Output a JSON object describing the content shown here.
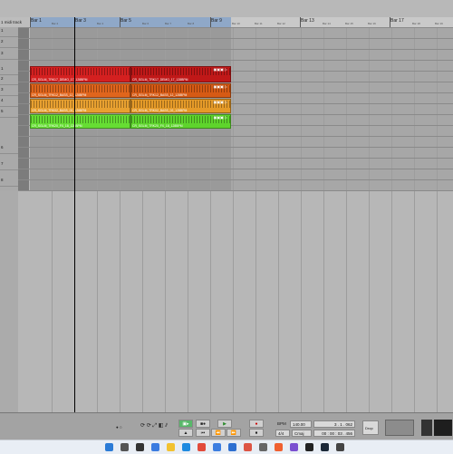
{
  "header": {
    "midi_label": "1 midi track"
  },
  "ruler": {
    "bars": [
      "Bar 1",
      "Bar 3",
      "Bar 5",
      "Bar 9",
      "Bar 13",
      "Bar 17"
    ],
    "beats": [
      "Bar 2",
      "Bar 4",
      "Bar 6",
      "Bar 7",
      "Bar 8",
      "Bar 10",
      "Bar 11",
      "Bar 12",
      "Bar 14",
      "Bar 15",
      "Bar 16",
      "Bar 18",
      "Bar 19"
    ]
  },
  "tracks": [
    "1",
    "2",
    "3",
    "1",
    "2",
    "3",
    "4",
    "5",
    "6",
    "7",
    "8"
  ],
  "clips": [
    {
      "name": "CR_SGLM_TRK17_DEMO_17_128BPM",
      "color": "#d42020"
    },
    {
      "name": "CR_SGLM_TRK17_DEMO_17_128BPM",
      "color": "#c01818"
    },
    {
      "name": "CR_SGLM_TRK12_BASS_12_128BPM",
      "color": "#e0651c"
    },
    {
      "name": "CR_SGLM_TRK12_BASS_12_128BPM",
      "color": "#d65a14"
    },
    {
      "name": "CR_SGLM_TRK02_BASS_02_128BPM",
      "color": "#e8a030"
    },
    {
      "name": "CR_SGLM_TRK02_BASS_02_128BPM",
      "color": "#e59a28"
    },
    {
      "name": "CR_SGLM_TRK20_FX_18_128BPM",
      "color": "#66dd33"
    },
    {
      "name": "CR_SGLM_TRK20_FX_18_128BPM",
      "color": "#5ed42c"
    }
  ],
  "transport": {
    "bpm_label": "BPM",
    "bpm_value": "140.00",
    "time_sig": "4/4",
    "key": "Cmaj",
    "position": "3 . 1 . 062",
    "time": "00 : 00 : 03 . 456",
    "mode_label": "Drop"
  },
  "taskbar": {
    "icons": [
      "windows-icon",
      "search-icon",
      "taskview-icon",
      "widgets-icon",
      "explorer-icon",
      "edge-icon",
      "chrome-icon",
      "store-icon",
      "mail-icon",
      "daw-icon",
      "settings-icon",
      "pen-icon",
      "photos-icon",
      "vpn-icon",
      "steam-icon",
      "app-icon"
    ]
  }
}
